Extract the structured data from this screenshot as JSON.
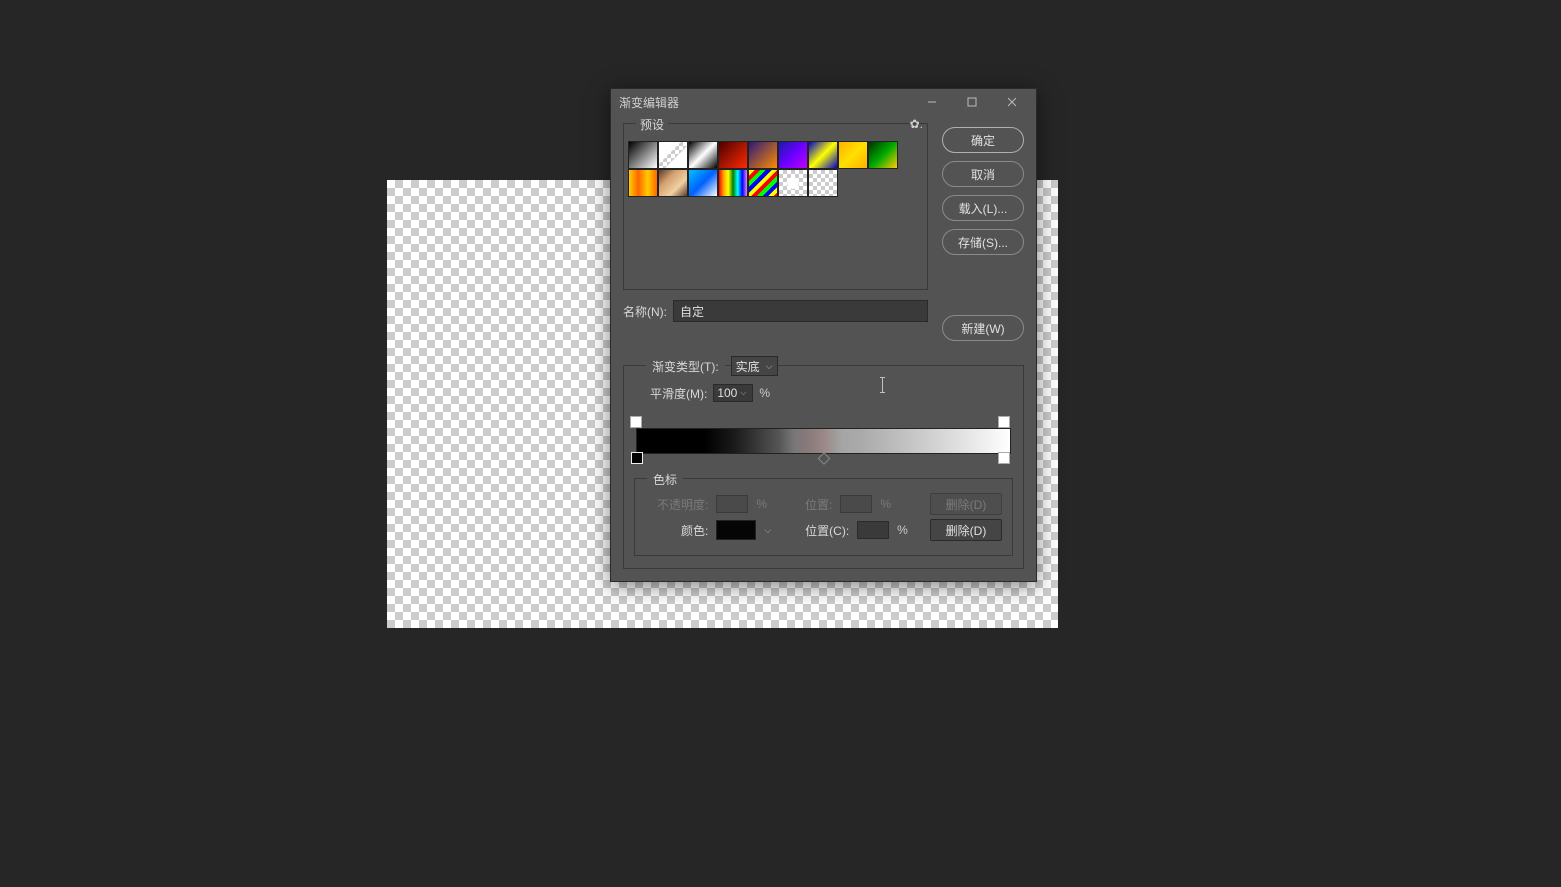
{
  "dialog": {
    "title": "渐变编辑器",
    "presets_label": "预设",
    "name_label": "名称(N):",
    "name_value": "自定",
    "gradient_type_label": "渐变类型(T):",
    "gradient_type_value": "实底",
    "smoothness_label": "平滑度(M):",
    "smoothness_value": "100",
    "percent": "%",
    "stops_label": "色标",
    "opacity_label": "不透明度:",
    "position_label": "位置:",
    "color_label": "颜色:",
    "position_c_label": "位置(C):",
    "delete_label": "删除(D)"
  },
  "buttons": {
    "ok": "确定",
    "cancel": "取消",
    "load": "载入(L)...",
    "save": "存储(S)...",
    "new": "新建(W)"
  },
  "swatches": [
    {
      "bg": "linear-gradient(135deg,#000,#fff)"
    },
    {
      "bg": "linear-gradient(135deg,#fff 0%,#fff 40%,transparent 41%,transparent 59%,#fff 60%), repeating-conic-gradient(#ccc 0 25%,#fff 0 50%)",
      "bgsize": "100% 100%, 8px 8px"
    },
    {
      "bg": "linear-gradient(135deg,#000,#fff,#000)"
    },
    {
      "bg": "linear-gradient(135deg,#4a0000,#ff2a00)"
    },
    {
      "bg": "linear-gradient(135deg,#2b1a7a,#ff8a00)"
    },
    {
      "bg": "linear-gradient(135deg,#1a1aaa,#6a00ff,#c000ff)"
    },
    {
      "bg": "linear-gradient(135deg,#0000cc,#ffff00,#0000cc)"
    },
    {
      "bg": "linear-gradient(135deg,#ffb000,#ffe000,#ffb000)"
    },
    {
      "bg": "linear-gradient(135deg,#003300,#00aa00,#ffcc00)"
    },
    {
      "bg": "linear-gradient(90deg,#ffcc00,#ff6600,#ffcc00,#ff6600)"
    },
    {
      "bg": "linear-gradient(135deg,#5a3a2a,#d4a070,#f0d0a0,#5a3a2a)"
    },
    {
      "bg": "linear-gradient(135deg,#00c0ff,#0060ff,#fff)"
    },
    {
      "bg": "linear-gradient(90deg,red,orange,yellow,green,cyan,blue,violet)"
    },
    {
      "bg": "repeating-linear-gradient(135deg,#ff0 0 4px,#f00 4px 8px,#0f0 8px 12px,#00f 12px 16px)"
    },
    {
      "bg": "radial-gradient(circle,#fff 30%, transparent 31%), repeating-conic-gradient(#ccc 0 25%,#fff 0 50%)",
      "bgsize": "100% 100%, 8px 8px"
    },
    {
      "bg": "repeating-conic-gradient(#ccc 0 25%,#fff 0 50%)",
      "bgsize": "8px 8px"
    }
  ],
  "gradient_stops": {
    "opacity": [
      {
        "pos": 0
      },
      {
        "pos": 100
      }
    ],
    "color": [
      {
        "pos": 0,
        "selected": true
      },
      {
        "pos": 100,
        "selected": false
      }
    ],
    "midpoint": 50
  }
}
